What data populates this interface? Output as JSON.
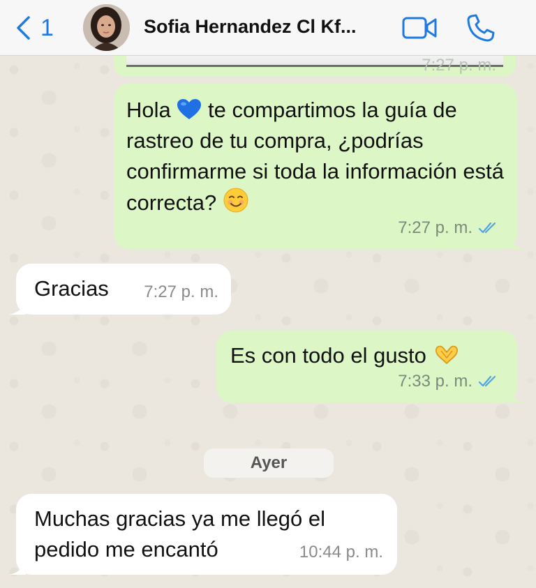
{
  "header": {
    "back_count": "1",
    "contact_name": "Sofia Hernandez Cl Kf...",
    "icons": {
      "back": "chevron-left-icon",
      "video": "video-camera-icon",
      "call": "phone-icon"
    },
    "accent_color": "#1f7ae0"
  },
  "previous_message": {
    "time": "7:27 p. m."
  },
  "messages": [
    {
      "direction": "outgoing",
      "text_part1": "Hola",
      "text_part2": " te compartimos la guía de rastreo de tu compra, ¿podrías confirmarme si toda la información está correcta?",
      "emojis": [
        "blue-heart",
        "smiling-face"
      ],
      "time": "7:27 p. m.",
      "status": "read"
    },
    {
      "direction": "incoming",
      "text": "Gracias",
      "time": "7:27 p. m."
    },
    {
      "direction": "outgoing",
      "text": "Es con todo el gusto",
      "emojis": [
        "heart-hands"
      ],
      "time": "7:33 p. m.",
      "status": "read"
    },
    {
      "direction": "incoming",
      "text": "Muchas gracias ya me llegó el pedido me encantó",
      "time": "10:44 p. m."
    }
  ],
  "day_separator": "Ayer",
  "colors": {
    "outgoing_bubble": "#dcf7c5",
    "incoming_bubble": "#ffffff",
    "read_ticks": "#4fa3e8"
  }
}
